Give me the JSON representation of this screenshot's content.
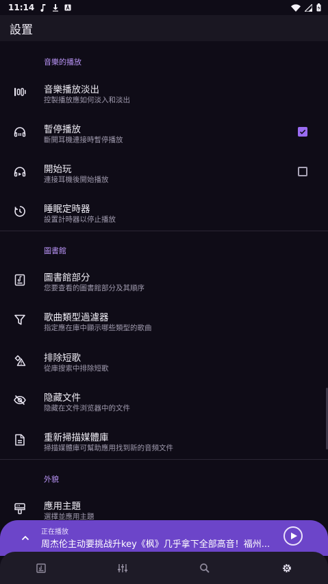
{
  "status_bar": {
    "time": "11:14",
    "icons": [
      "music-note-icon",
      "download-icon",
      "app-notification-icon"
    ],
    "right_icons": [
      "wifi-icon",
      "signal-icon",
      "battery-icon"
    ]
  },
  "app_bar": {
    "title": "設置"
  },
  "sections": [
    {
      "header": "音樂的播放",
      "items": [
        {
          "icon": "fade-bars-icon",
          "title": "音樂播放淡出",
          "subtitle": "控製播放應如何淡入和淡出"
        },
        {
          "icon": "headphones-icon",
          "title": "暫停播放",
          "subtitle": "斷開耳機連接時暫停播放",
          "checked": true
        },
        {
          "icon": "headphones-play-icon",
          "title": "開始玩",
          "subtitle": "連接耳機後開始播放",
          "checked": false
        },
        {
          "icon": "sleep-timer-icon",
          "title": "睡眠定時器",
          "subtitle": "設置計時器以停止播放"
        }
      ]
    },
    {
      "header": "圖書館",
      "items": [
        {
          "icon": "library-book-icon",
          "title": "圖書館部分",
          "subtitle": "您要查看的圖書館部分及其順序"
        },
        {
          "icon": "filter-icon",
          "title": "歌曲類型過濾器",
          "subtitle": "指定應在庫中顯示哪些類型的歌曲"
        },
        {
          "icon": "warning-shapes-icon",
          "title": "排除短歌",
          "subtitle": "從庫搜索中排除短歌"
        },
        {
          "icon": "eye-off-icon",
          "title": "隐藏文件",
          "subtitle": "隐藏在文件浏览器中的文件"
        },
        {
          "icon": "document-icon",
          "title": "重新掃描媒體庫",
          "subtitle": "掃描媒體庫可幫助應用找到新的音頻文件"
        }
      ]
    },
    {
      "header": "外貌",
      "items": [
        {
          "icon": "theme-brush-icon",
          "title": "應用主題",
          "subtitle": "選擇並應用主題"
        }
      ]
    }
  ],
  "now_playing": {
    "label": "正在播放",
    "title": "周杰伦主动要挑战升key《枫》几乎拿下全部高音！福州..."
  },
  "bottom_nav": [
    "library-tab-icon",
    "equalizer-tab-icon",
    "search-tab-icon",
    "settings-tab-icon"
  ],
  "colors": {
    "accent": "#9a6cf2",
    "now_playing_bg": "#6c45c9",
    "background": "#0f0c17"
  }
}
